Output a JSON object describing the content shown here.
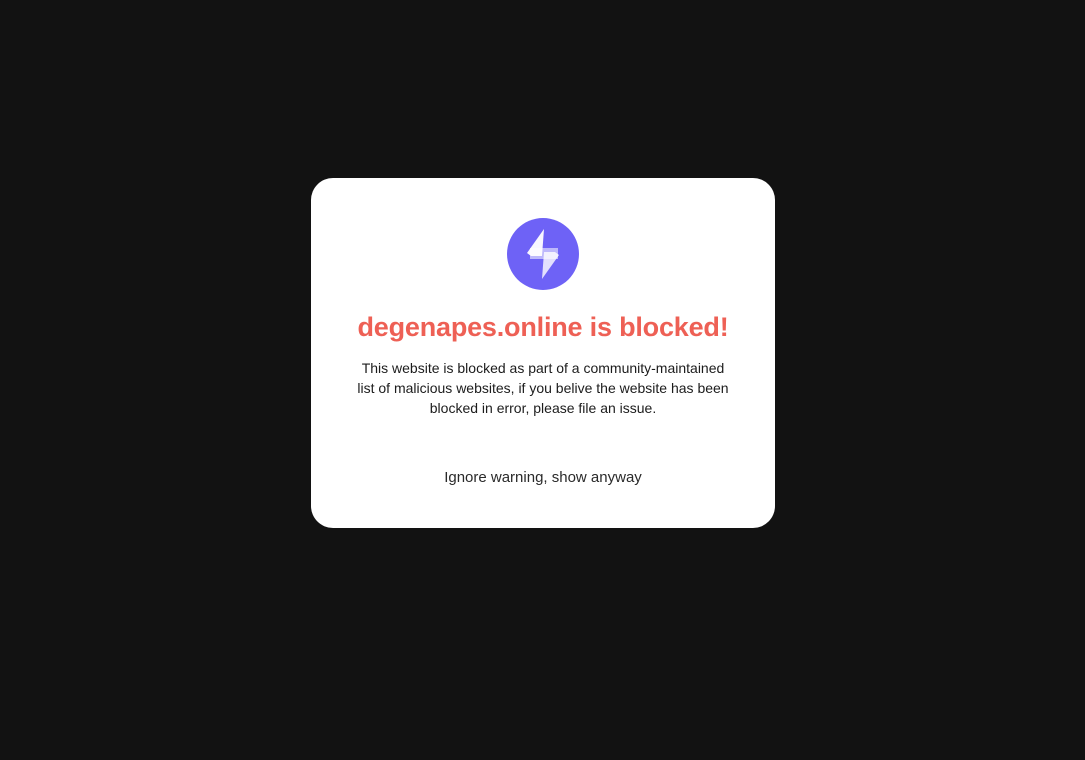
{
  "colors": {
    "background": "#121212",
    "card": "#ffffff",
    "title": "#ee6055",
    "logo_circle": "#6e62f6",
    "logo_bolt": "#ffffff"
  },
  "logo": {
    "icon": "lightning-bolt-icon"
  },
  "block_notice": {
    "title": "degenapes.online is blocked!",
    "description": "This website is blocked as part of a community-maintained list of malicious websites, if you belive the website has been blocked in error, please file an issue.",
    "ignore_button_label": "Ignore warning, show anyway"
  }
}
